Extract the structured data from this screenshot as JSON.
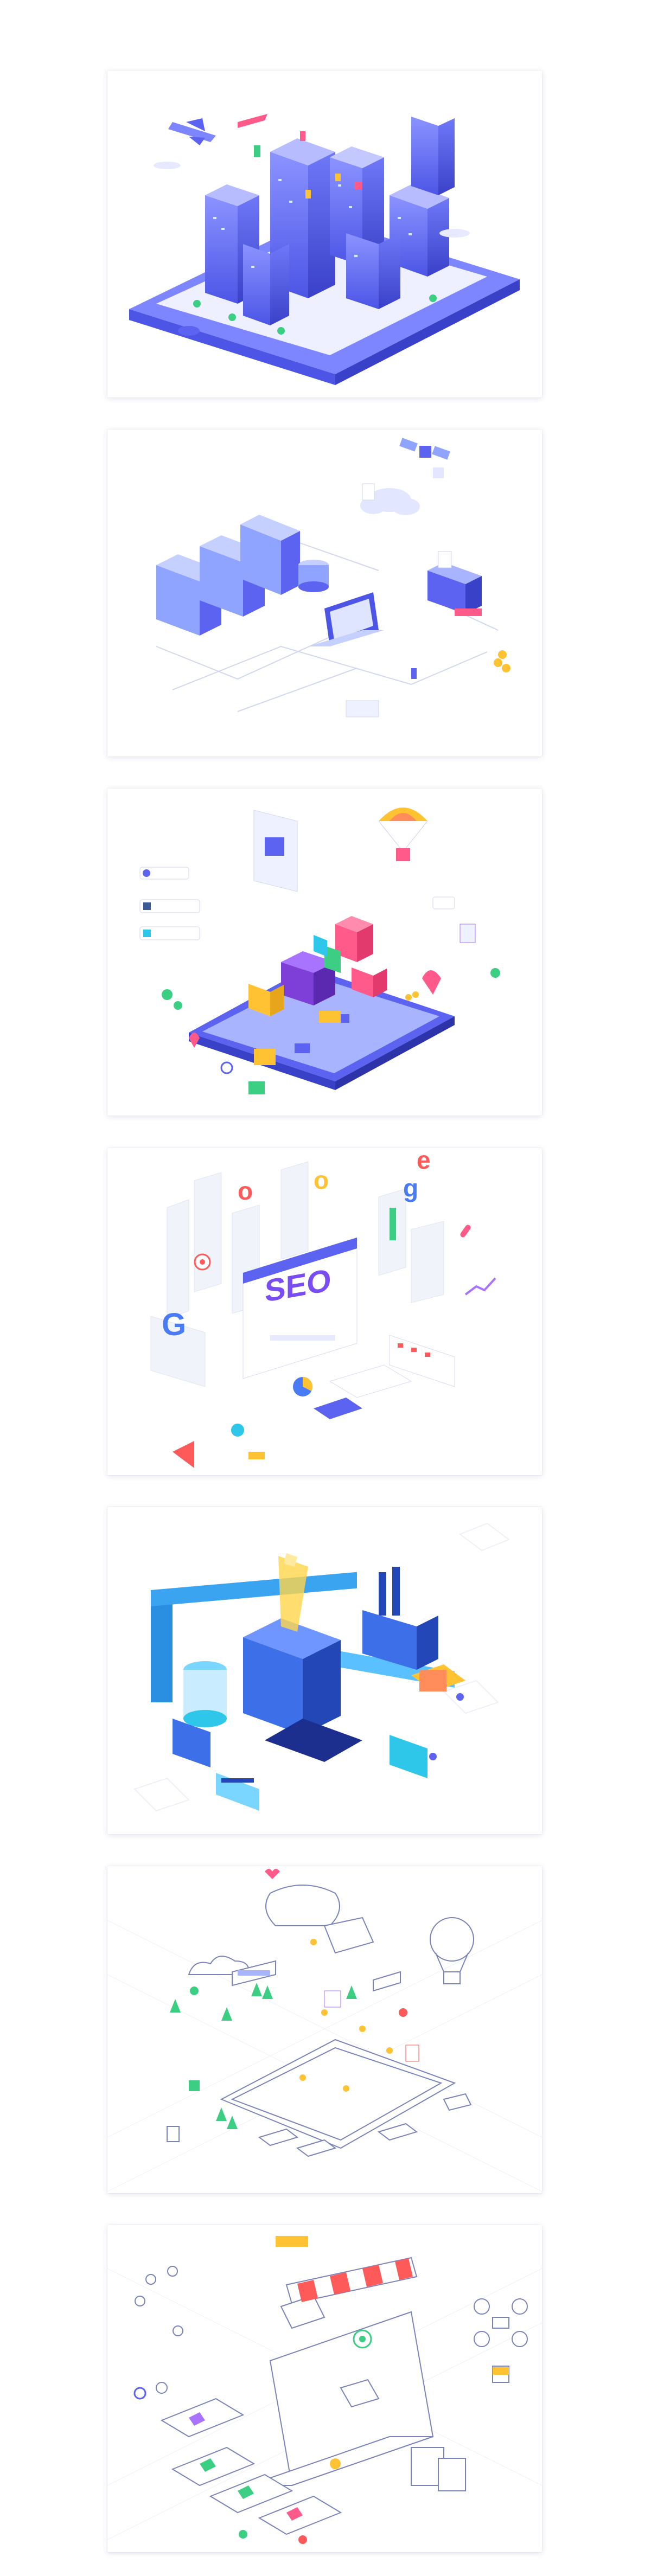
{
  "cards": [
    {
      "name": "smart-city-phone-illustration"
    },
    {
      "name": "cloud-data-server-illustration"
    },
    {
      "name": "mobile-shopping-gifts-illustration"
    },
    {
      "name": "seo-google-illustration",
      "seo_text": "SEO",
      "google_letters": [
        "G",
        "o",
        "o",
        "g",
        "l",
        "e"
      ]
    },
    {
      "name": "industrial-factory-illustration"
    },
    {
      "name": "line-mobile-banking-illustration"
    },
    {
      "name": "line-online-store-illustration"
    }
  ],
  "colors": {
    "primary_blue": "#5b63f0",
    "light_blue": "#a9b4ff",
    "cyan": "#2ec7ea",
    "pink": "#ff5a8a",
    "yellow": "#ffc233",
    "green": "#3ccf83",
    "gray_line": "#c9cfe6"
  }
}
